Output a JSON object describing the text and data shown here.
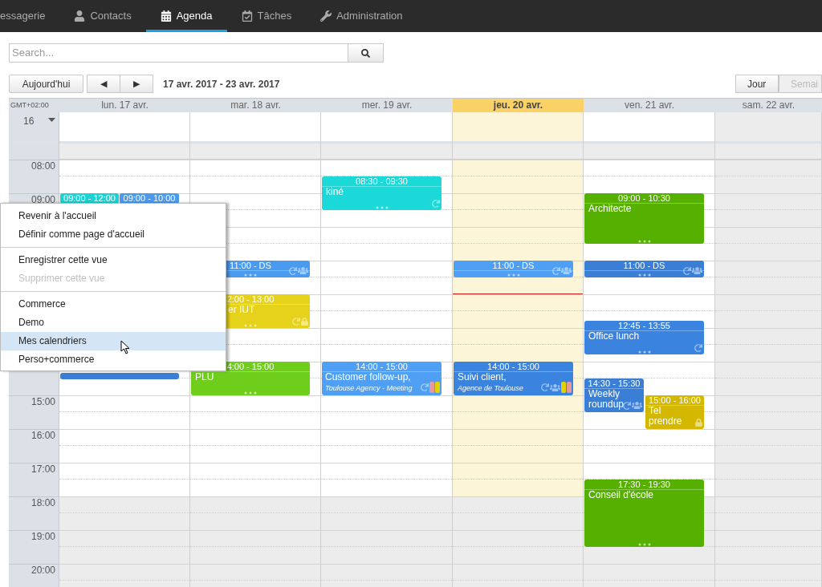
{
  "nav": {
    "items": [
      {
        "label": "essagerie",
        "selected": false
      },
      {
        "label": "Contacts",
        "selected": false
      },
      {
        "label": "Agenda",
        "selected": true
      },
      {
        "label": "Tâches",
        "selected": false
      },
      {
        "label": "Administration",
        "selected": false
      }
    ]
  },
  "search": {
    "placeholder": "Search..."
  },
  "toolbar": {
    "today_button": "Aujourd'hui",
    "prev": "◀",
    "next": "▶",
    "range": "17 avr. 2017 - 23 avr. 2017",
    "views": [
      {
        "label": "Jour",
        "selected": false
      },
      {
        "label": "Semai",
        "selected": true
      }
    ]
  },
  "calendar": {
    "timezone": "GMT+02:00",
    "allday_label": "16",
    "hours_top": [
      "08:00",
      "09:00"
    ],
    "hours_bottom": [
      "15:00",
      "16:00",
      "17:00",
      "18:00",
      "19:00",
      "20:00"
    ],
    "days": [
      {
        "label": "lun. 17 avr.",
        "today": false,
        "weekend": false,
        "events": [
          {
            "time": "09:00 - 12:00",
            "color": "#1bd3d3"
          },
          {
            "time": "09:00 - 10:00",
            "color": "#4a9af0"
          },
          {
            "color": "#3a7fd5"
          }
        ]
      },
      {
        "label": "mar. 18 avr.",
        "today": false,
        "weekend": false,
        "events": [
          {
            "time": "11:00 - DS",
            "color": "#4a9af0",
            "recurring": true,
            "shared": true,
            "private": false
          },
          {
            "time": "2:00 - 13:00",
            "title": "er IUT",
            "color": "#e6d21b",
            "recurring": true,
            "shared": false,
            "private": true
          },
          {
            "time": "4:00 - 15:00",
            "title": "PLU",
            "color": "#6fce1c",
            "recurring": false,
            "shared": false,
            "private": false
          }
        ]
      },
      {
        "label": "mer. 19 avr.",
        "today": false,
        "weekend": false,
        "events": [
          {
            "time": "08:30 - 09:30",
            "title": "kiné",
            "color": "#1bd9d9",
            "recurring": true,
            "shared": false,
            "private": false
          },
          {
            "time": "14:00 - 15:00",
            "title": "Customer follow-up, *Toulouse Agency - Meeting*",
            "color": "#4f9ff5",
            "recurring": true,
            "shared": false,
            "private": false,
            "chips": [
              {
                "color": "#e89a9a"
              },
              {
                "color": "#e3d100"
              }
            ]
          }
        ]
      },
      {
        "label": "jeu. 20 avr.",
        "today": true,
        "weekend": false,
        "events": [
          {
            "time": "11:00 - DS",
            "color": "#4f9ff5",
            "recurring": true,
            "shared": true,
            "private": false
          },
          {
            "time": "14:00 - 15:00",
            "title": "Suivi client, *Agence de Toulouse*",
            "color": "#3a84e0",
            "recurring": true,
            "shared": true,
            "private": false,
            "chips": [
              {
                "color": "#e3d100"
              },
              {
                "color": "#e89a9a"
              }
            ]
          }
        ]
      },
      {
        "label": "ven. 21 avr.",
        "today": false,
        "weekend": false,
        "events": [
          {
            "time": "09:00 - 10:30",
            "title": "Architecte",
            "color": "#55b000",
            "recurring": false,
            "shared": false,
            "private": false
          },
          {
            "time": "11:00 - DS",
            "color": "#3a7fd5",
            "recurring": true,
            "shared": true,
            "private": false
          },
          {
            "time": "12:45 - 13:55",
            "title": "Office lunch",
            "color": "#3a84e0",
            "recurring": true,
            "shared": false,
            "private": false
          },
          {
            "time": "14:30 - 15:30",
            "title": "Weekly roundup",
            "color": "#3a7fd5",
            "recurring": true,
            "shared": true,
            "private": false
          },
          {
            "time": "15:00 - 16:00",
            "title": "Tel prendre",
            "color": "#d4b800",
            "recurring": false,
            "shared": false,
            "private": true
          },
          {
            "time": "17:30 - 19:30",
            "title": "Conseil d'école",
            "color": "#55b000",
            "recurring": false,
            "shared": false,
            "private": false
          }
        ]
      },
      {
        "label": "sam. 22 avr.",
        "today": false,
        "weekend": true
      }
    ]
  },
  "menu": {
    "sections": [
      [
        {
          "label": "Revenir à l'accueil",
          "disabled": false,
          "selected": false
        },
        {
          "label": "Définir comme page d'accueil",
          "disabled": false,
          "selected": false
        }
      ],
      [
        {
          "label": "Enregistrer cette vue",
          "disabled": false,
          "selected": false
        },
        {
          "label": "Supprimer cette vue",
          "disabled": true,
          "selected": false
        }
      ],
      [
        {
          "label": "Commerce",
          "disabled": false,
          "selected": false
        },
        {
          "label": "Demo",
          "disabled": false,
          "selected": false
        },
        {
          "label": "Mes calendriers",
          "disabled": false,
          "selected": true
        },
        {
          "label": "Perso+commerce",
          "disabled": false,
          "selected": false
        }
      ]
    ]
  }
}
